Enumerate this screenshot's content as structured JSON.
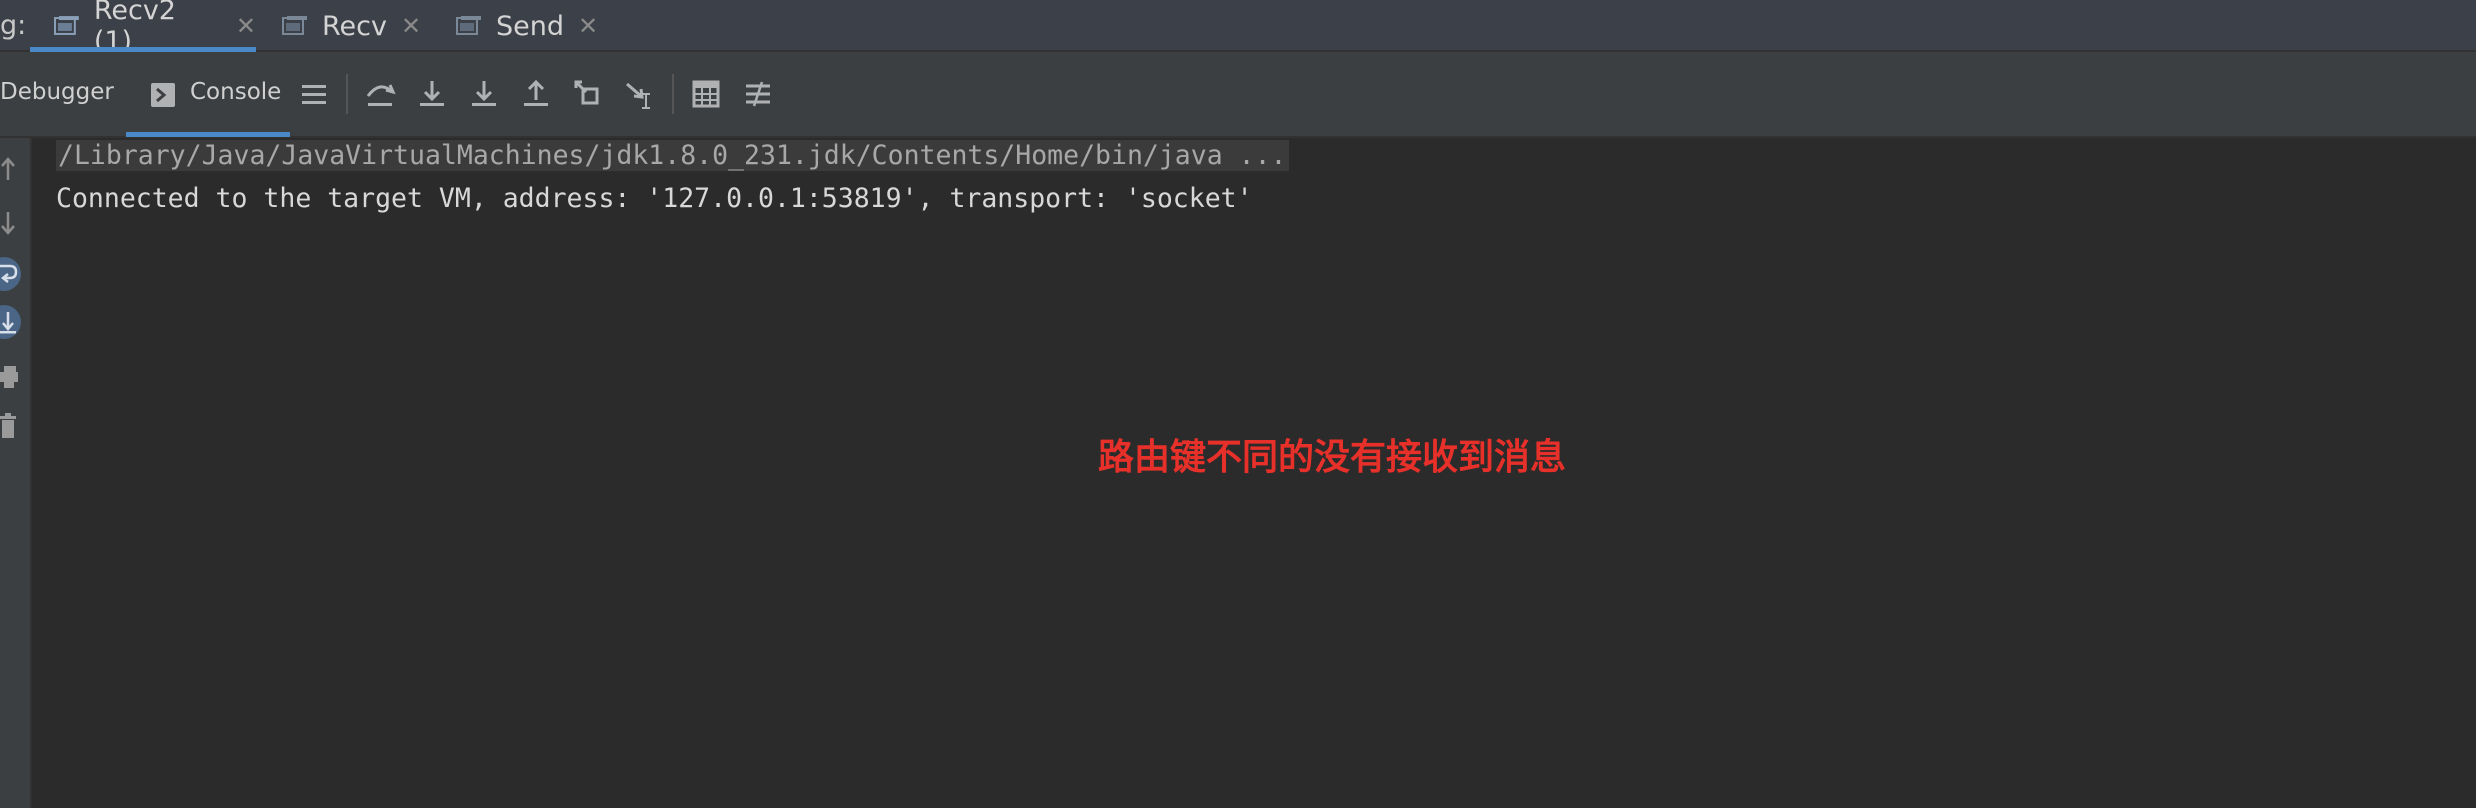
{
  "tabbar": {
    "prefix": "g:",
    "tabs": [
      {
        "label": "Recv2 (1)",
        "active": true,
        "icon": "run-config-icon"
      },
      {
        "label": "Recv",
        "active": false,
        "icon": "run-config-icon"
      },
      {
        "label": "Send",
        "active": false,
        "icon": "run-config-icon"
      }
    ],
    "close_glyph": "✕"
  },
  "toolbar": {
    "debugger_label": "Debugger",
    "console_label": "Console",
    "icons": [
      "frames-menu-icon",
      "step-over-icon",
      "step-into-icon",
      "force-step-into-icon",
      "step-out-icon",
      "drop-frame-icon",
      "run-to-cursor-icon",
      "evaluate-expression-icon",
      "trace-icon"
    ]
  },
  "gutter": {
    "icons": [
      "up-arrow-icon",
      "down-arrow-icon",
      "soft-wrap-icon",
      "scroll-to-end-icon",
      "print-icon",
      "trash-icon"
    ]
  },
  "console": {
    "command_line": "/Library/Java/JavaVirtualMachines/jdk1.8.0_231.jdk/Contents/Home/bin/java ...",
    "output_line": "Connected to the target VM, address: '127.0.0.1:53819', transport: 'socket'"
  },
  "annotation": {
    "text": "路由键不同的没有接收到消息",
    "color": "#e8302a"
  },
  "colors": {
    "accent": "#4a88c7",
    "background": "#2b2b2b",
    "toolbar": "#3c3f41"
  }
}
